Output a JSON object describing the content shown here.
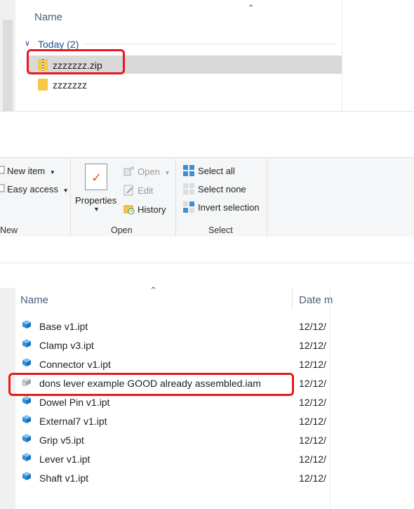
{
  "top_panel": {
    "name_header": "Name",
    "group_label": "Today (2)",
    "items": [
      {
        "label": "zzzzzzz.zip",
        "icon": "zip-folder-icon"
      },
      {
        "label": "zzzzzzz",
        "icon": "folder-icon"
      }
    ]
  },
  "ribbon": {
    "new_group": {
      "new_item": "New item",
      "easy_access": "Easy access",
      "label": "New"
    },
    "open_group": {
      "properties": "Properties",
      "open": "Open",
      "edit": "Edit",
      "history": "History",
      "label": "Open"
    },
    "select_group": {
      "select_all": "Select all",
      "select_none": "Select none",
      "invert_selection": "Invert selection",
      "label": "Select"
    }
  },
  "file_list": {
    "name_header": "Name",
    "date_header": "Date m",
    "rows": [
      {
        "name": "Base v1.ipt",
        "date": "12/12/",
        "icon": "part-cube-icon"
      },
      {
        "name": "Clamp v3.ipt",
        "date": "12/12/",
        "icon": "part-cube-icon"
      },
      {
        "name": "Connector v1.ipt",
        "date": "12/12/",
        "icon": "part-cube-icon"
      },
      {
        "name": "dons lever example GOOD already assembled.iam",
        "date": "12/12/",
        "icon": "assembly-icon"
      },
      {
        "name": "Dowel Pin v1.ipt",
        "date": "12/12/",
        "icon": "part-cube-icon"
      },
      {
        "name": "External7 v1.ipt",
        "date": "12/12/",
        "icon": "part-cube-icon"
      },
      {
        "name": "Grip v5.ipt",
        "date": "12/12/",
        "icon": "part-cube-icon"
      },
      {
        "name": "Lever v1.ipt",
        "date": "12/12/",
        "icon": "part-cube-icon"
      },
      {
        "name": "Shaft v1.ipt",
        "date": "12/12/",
        "icon": "part-cube-icon"
      }
    ]
  },
  "colors": {
    "highlight": "#e8191c",
    "accent": "#1e4e8c",
    "selected_row": "#d9d9d9"
  }
}
